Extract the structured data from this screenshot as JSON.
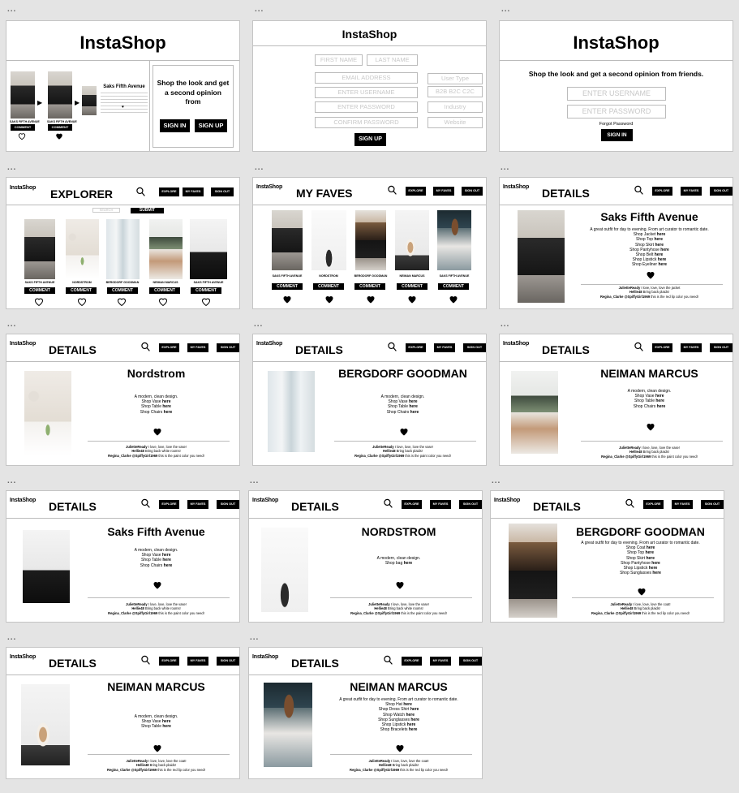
{
  "brand": "InstaShop",
  "nav": {
    "explore": "EXPLORE",
    "faves": "MY FAVES",
    "signout": "SIGN OUT"
  },
  "frame_menu": "...",
  "comment": "COMMENT",
  "details_title": "DETAILS",
  "landing": {
    "store": "Saks Fifth Avenue",
    "caption": "SAKS FIFTH AVENUE",
    "tagline": "Shop the look and get a second opinion from",
    "signin": "SIGN IN",
    "signup": "SIGN UP"
  },
  "signup": {
    "first": "FIRST NAME",
    "last": "LAST NAME",
    "email": "EMAIL ADDRESS",
    "username": "ENTER USERNAME",
    "password": "ENTER PASSWORD",
    "confirm": "CONFIRM PASSWORD",
    "usertype": "User Type",
    "b2b": "B2B B2C C2C",
    "industry": "Industry",
    "website": "Website",
    "button": "SIGN UP"
  },
  "signin": {
    "tagline": "Shop the look and get a second opinion from friends.",
    "username": "ENTER USERNAME",
    "password": "ENTER PASSWORD",
    "forgot": "Forgot Password",
    "button": "SIGN IN"
  },
  "explorer": {
    "title": "EXPLORER",
    "search_placeholder": "SEARCH",
    "submit": "SUBMIT",
    "items": [
      "SAKS FIFTH AVENUE",
      "NORDSTROM",
      "BERGDORF GOODMAN",
      "NEIMAN MARCUS",
      "SAKS FIFTH AVENUE"
    ]
  },
  "faves": {
    "title": "MY FAVES",
    "items": [
      "SAKS FIFTH AVENUE",
      "NORDSTROM",
      "BERGDORF GOODMAN",
      "NEIMAN MARCUS",
      "SAKS FIFTH AVENUE"
    ]
  },
  "details": [
    {
      "store": "Saks Fifth Avenue",
      "desc": "A great outfit for day to evening.  From art curator to romantic date.",
      "shop": [
        "Shop Jacket",
        "Shop Top",
        "Shop Skirt",
        "Shop Pantyhose",
        "Shop Belt",
        "Shop Lipstick",
        "Shop Eyeliner"
      ],
      "comments": [
        [
          "JulietteReady",
          "I love, love, love the jacket"
        ],
        [
          "Hellie48",
          "Bring back plaids!"
        ],
        [
          "Regina_Clarke @SpiffyGirl1969",
          "this is the red lip color you need!"
        ]
      ]
    },
    {
      "store": "Nordstrom",
      "desc": "A modern, clean design.",
      "shop": [
        "Shop Vase",
        "Shop Table",
        "Shop Chairs"
      ],
      "comments": [
        [
          "JulietteReady",
          "I love, love, love the vase!"
        ],
        [
          "Hellie48",
          "Bring back white rooms!"
        ],
        [
          "Regina_Clarke @SpiffyGirl1969",
          "this is the paint color you need!"
        ]
      ]
    },
    {
      "store": "BERGDORF GOODMAN",
      "desc": "A modern, clean design.",
      "shop": [
        "Shop Vase",
        "Shop Table",
        "Shop Chairs"
      ],
      "comments": [
        [
          "JulietteReady",
          "I love, love, love the vase!"
        ],
        [
          "Hellie48",
          "Bring back plaids!"
        ],
        [
          "Regina_Clarke @SpiffyGirl1969",
          "this is the paint color you need!"
        ]
      ]
    },
    {
      "store": "NEIMAN MARCUS",
      "desc": "A modern, clean design.",
      "shop": [
        "Shop Vase",
        "Shop Table",
        "Shop Chairs"
      ],
      "comments": [
        [
          "JulietteReady",
          "I love, love, love the vase!"
        ],
        [
          "Hellie48",
          "Bring back plaids!"
        ],
        [
          "Regina_Clarke @SpiffyGirl1969",
          "this is the paint color you need!"
        ]
      ]
    },
    {
      "store": "Saks Fifth Avenue",
      "desc": "A modern, clean design.",
      "shop": [
        "Shop Vase",
        "Shop Table",
        "Shop Chairs"
      ],
      "comments": [
        [
          "JulietteReady",
          "I love, love, love the vase!"
        ],
        [
          "Hellie48",
          "Bring back white rooms!"
        ],
        [
          "Regina_Clarke @SpiffyGirl1969",
          "this is the paint color you need!"
        ]
      ]
    },
    {
      "store": "NORDSTROM",
      "desc": "A modern, clean design.",
      "shop": [
        "Shop bag"
      ],
      "comments": [
        [
          "JulietteReady",
          "I love, love, love the vase!"
        ],
        [
          "Hellie48",
          "Bring back white rooms!"
        ],
        [
          "Regina_Clarke @SpiffyGirl1969",
          "this is the paint color you need!"
        ]
      ]
    },
    {
      "store": "BERGDORF GOODMAN",
      "desc": "A great outfit for day to evening.  From art curator to romantic date.",
      "shop": [
        "Shop Coat",
        "Shop Top",
        "Shop Skirt",
        "Shop Pantyhose",
        "Shop Lipstick",
        "Shop Sunglasses"
      ],
      "comments": [
        [
          "JulietteReady",
          "I love, love, love the coat!"
        ],
        [
          "Hellie48",
          "Bring back plaids!"
        ],
        [
          "Regina_Clarke @SpiffyGirl1969",
          "this is the red lip color you need!"
        ]
      ]
    },
    {
      "store": "NEIMAN MARCUS",
      "desc": "A modern, clean design.",
      "shop": [
        "Shop Vase",
        "Shop Table"
      ],
      "comments": [
        [
          "JulietteReady",
          "I love, love, love the coat!"
        ],
        [
          "Hellie48",
          "Bring back plaids!"
        ],
        [
          "Regina_Clarke @SpiffyGirl1969",
          "this is the red lip color you need!"
        ]
      ]
    },
    {
      "store": "NEIMAN MARCUS",
      "desc": "A great outfit for day to evening.  From art curator to romantic date.",
      "shop": [
        "Shop Hat",
        "Shop Dress Shirt",
        "Shop Watch",
        "Shop Sunglasses",
        "Shop Lipstick",
        "Shop Bracelets"
      ],
      "comments": [
        [
          "JulietteReady",
          "I love, love, love the coat!"
        ],
        [
          "Hellie48",
          "Bring back plaids!"
        ],
        [
          "Regina_Clarke @SpiffyGirl1969",
          "this is the red lip color you need!"
        ]
      ]
    }
  ],
  "here": "here"
}
